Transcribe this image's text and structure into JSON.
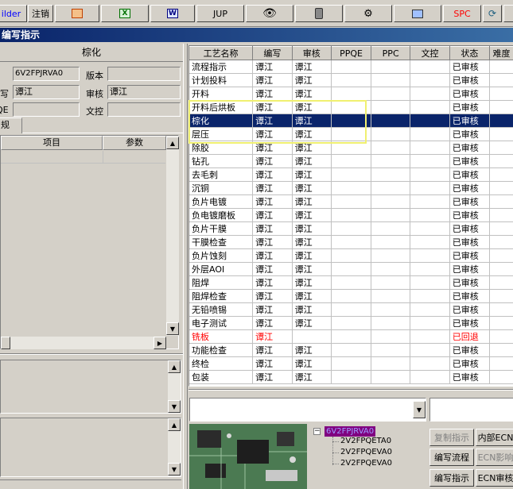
{
  "toolbar": {
    "items": [
      {
        "label": "ilder",
        "icon": "builder-icon",
        "color": "#0000ff"
      },
      {
        "label": "注销",
        "icon": "logout-icon"
      },
      {
        "label": "",
        "icon": "ppt-icon"
      },
      {
        "label": "",
        "icon": "excel-icon"
      },
      {
        "label": "W",
        "icon": "word-icon"
      },
      {
        "label": "JUP",
        "icon": "jup-icon"
      },
      {
        "label": "",
        "icon": "eye-icon"
      },
      {
        "label": "",
        "icon": "database-icon"
      },
      {
        "label": "",
        "icon": "network-icon"
      },
      {
        "label": "",
        "icon": "computer-icon"
      },
      {
        "label": "SPC",
        "icon": "spc-icon",
        "color": "#ff0000"
      },
      {
        "label": "",
        "icon": "refresh-icon"
      }
    ]
  },
  "window": {
    "title": "编写指示"
  },
  "left": {
    "panel_title": "棕化",
    "fields": {
      "code_value": "6V2FPJRVA0",
      "version_label": "版本",
      "version_value": "",
      "writer_label": "写",
      "writer_value": "谭江",
      "audit_label": "审核",
      "audit_value": "谭江",
      "qe_label": "QE",
      "qe_value": "",
      "doc_label": "文控",
      "doc_value": ""
    },
    "tab_label": "规",
    "param_table": {
      "col_item": "项目",
      "col_param": "参数"
    }
  },
  "process_table": {
    "headers": [
      "工艺名称",
      "编写",
      "审核",
      "PPQE",
      "PPC",
      "文控",
      "状态",
      "难度"
    ],
    "rows": [
      {
        "name": "流程指示",
        "writer": "谭江",
        "auditor": "谭江",
        "status": "已审核"
      },
      {
        "name": "计划投料",
        "writer": "谭江",
        "auditor": "谭江",
        "status": "已审核"
      },
      {
        "name": "开料",
        "writer": "谭江",
        "auditor": "谭江",
        "status": "已审核"
      },
      {
        "name": "开料后烘板",
        "writer": "谭江",
        "auditor": "谭江",
        "status": "已审核"
      },
      {
        "name": "棕化",
        "writer": "谭江",
        "auditor": "谭江",
        "status": "已审核",
        "selected": true
      },
      {
        "name": "层压",
        "writer": "谭江",
        "auditor": "谭江",
        "status": "已审核"
      },
      {
        "name": "除胶",
        "writer": "谭江",
        "auditor": "谭江",
        "status": "已审核"
      },
      {
        "name": "钻孔",
        "writer": "谭江",
        "auditor": "谭江",
        "status": "已审核"
      },
      {
        "name": "去毛刺",
        "writer": "谭江",
        "auditor": "谭江",
        "status": "已审核"
      },
      {
        "name": "沉铜",
        "writer": "谭江",
        "auditor": "谭江",
        "status": "已审核"
      },
      {
        "name": "负片电镀",
        "writer": "谭江",
        "auditor": "谭江",
        "status": "已审核"
      },
      {
        "name": "负电镀磨板",
        "writer": "谭江",
        "auditor": "谭江",
        "status": "已审核"
      },
      {
        "name": "负片干膜",
        "writer": "谭江",
        "auditor": "谭江",
        "status": "已审核"
      },
      {
        "name": "干膜检查",
        "writer": "谭江",
        "auditor": "谭江",
        "status": "已审核"
      },
      {
        "name": "负片蚀刻",
        "writer": "谭江",
        "auditor": "谭江",
        "status": "已审核"
      },
      {
        "name": "外层AOI",
        "writer": "谭江",
        "auditor": "谭江",
        "status": "已审核"
      },
      {
        "name": "阻焊",
        "writer": "谭江",
        "auditor": "谭江",
        "status": "已审核"
      },
      {
        "name": "阻焊检查",
        "writer": "谭江",
        "auditor": "谭江",
        "status": "已审核"
      },
      {
        "name": "无铅喷锡",
        "writer": "谭江",
        "auditor": "谭江",
        "status": "已审核"
      },
      {
        "name": "电子测试",
        "writer": "谭江",
        "auditor": "谭江",
        "status": "已审核"
      },
      {
        "name": "铣板",
        "writer": "谭江",
        "auditor": "",
        "status": "已回退",
        "red": true
      },
      {
        "name": "功能检查",
        "writer": "谭江",
        "auditor": "谭江",
        "status": "已审核"
      },
      {
        "name": "终检",
        "writer": "谭江",
        "auditor": "谭江",
        "status": "已审核"
      },
      {
        "name": "包装",
        "writer": "谭江",
        "auditor": "谭江",
        "status": "已审核"
      }
    ]
  },
  "tree": {
    "root": "6V2FPJRVA0",
    "children": [
      "2V2FPQETA0",
      "2V2FPQEVA0",
      "2V2FPQEVA0"
    ]
  },
  "buttons": {
    "copy_instructions": "复制指示",
    "internal_ecn": "内部ECN",
    "edit_flow": "编写流程",
    "ecn_impact": "ECN影响",
    "edit_instructions": "编写指示",
    "ecn_audit": "ECN审核"
  }
}
